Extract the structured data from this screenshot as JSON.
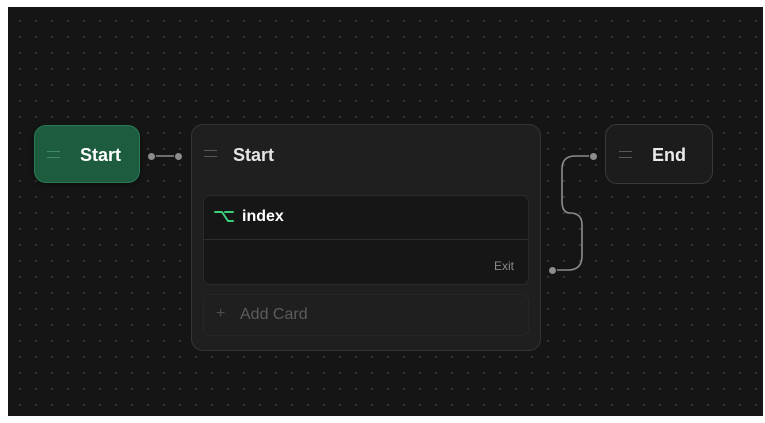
{
  "flow": {
    "start_node": {
      "title": "Start"
    },
    "card_node": {
      "title": "Start",
      "cards": [
        {
          "label": "index",
          "exit_label": "Exit"
        }
      ],
      "add_card_label": "Add Card",
      "add_card_icon": "+"
    },
    "end_node": {
      "title": "End"
    },
    "colors": {
      "background": "#151515",
      "start_node_fill": "#1d5c3f",
      "card_icon_green": "#3ecf7d",
      "connector": "#8c8c8c"
    },
    "icons": {
      "drag": "drag-handle-icon",
      "card": "branch-icon",
      "add": "plus-icon"
    }
  }
}
